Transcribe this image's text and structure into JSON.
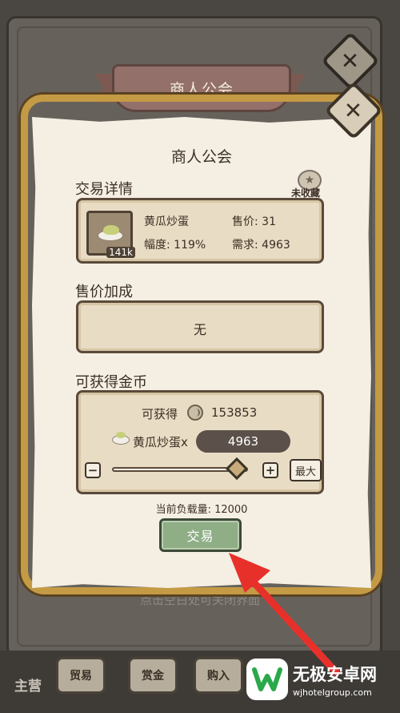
{
  "background": {
    "hint_text": "点击空白处可关闭界面",
    "bottom_left_label": "主营",
    "bottom_buttons": [
      "贸易",
      "赏金",
      "购入"
    ]
  },
  "header": {
    "ribbon_title": "商人公会"
  },
  "panel": {
    "title": "商人公会",
    "trade_details": {
      "label": "交易详情",
      "favorite_label": "未收藏",
      "item_name": "黄瓜炒蛋",
      "item_count": "141k",
      "price_label": "售价: 31",
      "change_label": "幅度: 119%",
      "demand_label": "需求: 4963"
    },
    "price_bonus": {
      "label": "售价加成",
      "value": "无"
    },
    "coins": {
      "label": "可获得金币",
      "earn_label": "可获得",
      "earn_value": "153853",
      "item_label": "黄瓜炒蛋x",
      "quantity": "4963",
      "minus": "−",
      "plus": "+",
      "max_label": "最大",
      "slider_fraction": 1.0
    },
    "load_text": "当前负载量: 12000",
    "trade_button": "交易"
  },
  "watermark": {
    "name": "无极安卓网",
    "url": "wjhotelgroup.com"
  },
  "colors": {
    "trade_button": "#8fae86",
    "arrow": "#e8302a",
    "frame_gold": "#c49a45"
  }
}
